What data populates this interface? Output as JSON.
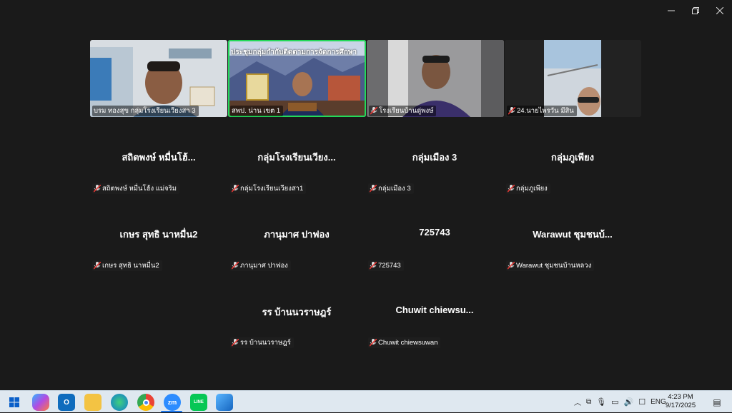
{
  "window_controls": {
    "minimize": "—",
    "restore": "❐",
    "close": "✕"
  },
  "video_tiles": [
    {
      "label": "บรม ทองสุข  กลุ่มโรงเรียนเวียงสา 3"
    },
    {
      "label": "สพป. น่าน เขต 1",
      "banner": "ประชุมกลุ่มกำกับติดตามการจัดการศึกษา"
    },
    {
      "label": "โรงเรียนบ้านดู่พงษ์"
    },
    {
      "label": "24.นายไพรวัน มีสิน"
    }
  ],
  "participants": [
    {
      "name": "สถิตพงษ์  หมื่นโฮ้...",
      "tag": "สถิตพงษ์  หมื่นโฮ้ง แม่จริม"
    },
    {
      "name": "กลุ่มโรงเรียนเวียง...",
      "tag": "กลุ่มโรงเรียนเวียงสา1"
    },
    {
      "name": "กลุ่มเมือง 3",
      "tag": "กลุ่มเมือง 3"
    },
    {
      "name": "กลุ่มภูเพียง",
      "tag": "กลุ่มภูเพียง"
    },
    {
      "name": "เกษร สุทธิ นาหมื่น2",
      "tag": "เกษร สุทธิ นาหมื่น2"
    },
    {
      "name": "ภานุมาศ ปาฟอง",
      "tag": "ภานุมาศ ปาฟอง"
    },
    {
      "name": "725743",
      "tag": "725743"
    },
    {
      "name": "Warawut ชุมชนบ้...",
      "tag": "Warawut ชุมชนบ้านหลวง"
    },
    {
      "name": "รร บ้านนวราษฎร์",
      "tag": "รร บ้านนวราษฎร์"
    },
    {
      "name": "Chuwit  chiewsu...",
      "tag": "Chuwit chiewsuwan"
    }
  ],
  "taskbar": {
    "apps": [
      "windows-start",
      "copilot",
      "outlook",
      "file-explorer",
      "edge",
      "chrome",
      "zoom",
      "line",
      "photos"
    ],
    "zoom_label": "zm",
    "line_label": "LINE",
    "language": "ENG",
    "time": "4:23 PM",
    "date": "9/17/2025"
  },
  "colors": {
    "active_speaker": "#23d959",
    "muted": "#e53935"
  }
}
